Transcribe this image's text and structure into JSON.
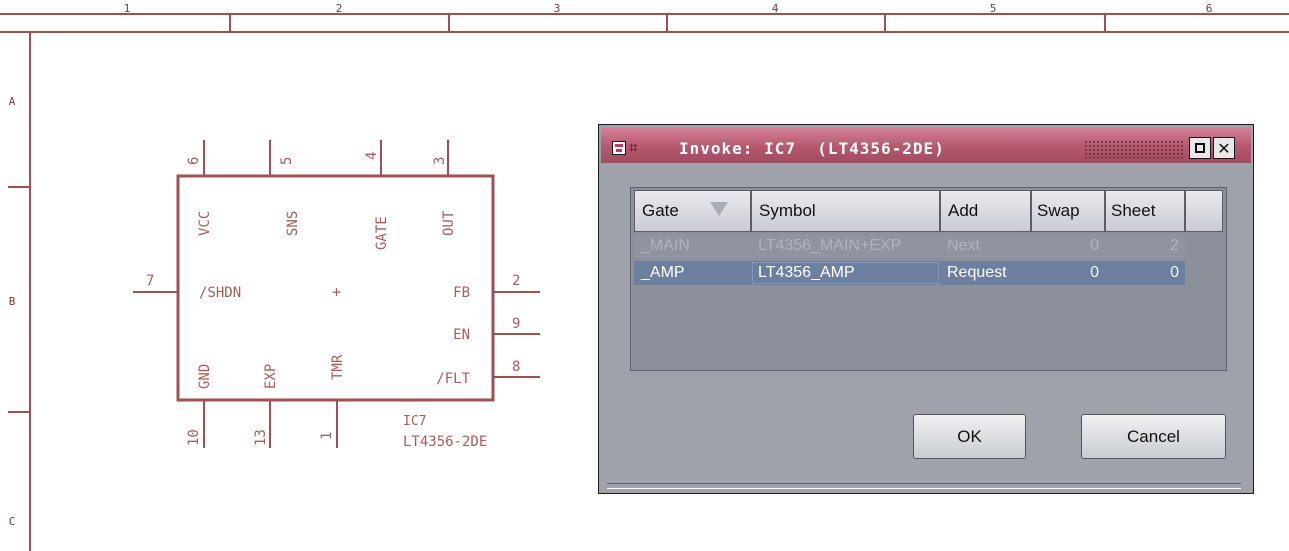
{
  "frame": {
    "columns": [
      "1",
      "2",
      "3",
      "4",
      "5",
      "6"
    ],
    "rows": [
      "A",
      "B",
      "C"
    ]
  },
  "schematic": {
    "part_name": "IC7",
    "part_value": "LT4356-2DE",
    "top_pins": [
      {
        "number": "6",
        "name": "VCC"
      },
      {
        "number": "5",
        "name": "SNS"
      },
      {
        "number": "4",
        "name": "GATE"
      },
      {
        "number": "3",
        "name": "OUT"
      }
    ],
    "left_pins": [
      {
        "number": "7",
        "name": "/SHDN"
      }
    ],
    "right_pins": [
      {
        "number": "2",
        "name": "FB"
      },
      {
        "number": "9",
        "name": "EN"
      },
      {
        "number": "8",
        "name": "/FLT"
      }
    ],
    "bottom_pins": [
      {
        "number": "10",
        "name": "GND"
      },
      {
        "number": "13",
        "name": "EXP"
      },
      {
        "number": "1",
        "name": "TMR"
      }
    ],
    "origin_mark": "+"
  },
  "dialog": {
    "title": "Invoke: IC7  (LT4356-2DE)",
    "columns": [
      "Gate",
      "Symbol",
      "Add",
      "Swap",
      "Sheet"
    ],
    "rows": [
      {
        "gate": "_MAIN",
        "symbol": "LT4356_MAIN+EXP",
        "add": "Next",
        "swap": "0",
        "sheet": "2"
      },
      {
        "gate": "_AMP",
        "symbol": "LT4356_AMP",
        "add": "Request",
        "swap": "0",
        "sheet": "0"
      }
    ],
    "ok_label": "OK",
    "cancel_label": "Cancel"
  },
  "colors": {
    "schematic_line": "#a0504f",
    "titlebar": "#b4586f",
    "dialog_bg": "#9ea3ab",
    "selected_row": "#6d7f9e"
  }
}
